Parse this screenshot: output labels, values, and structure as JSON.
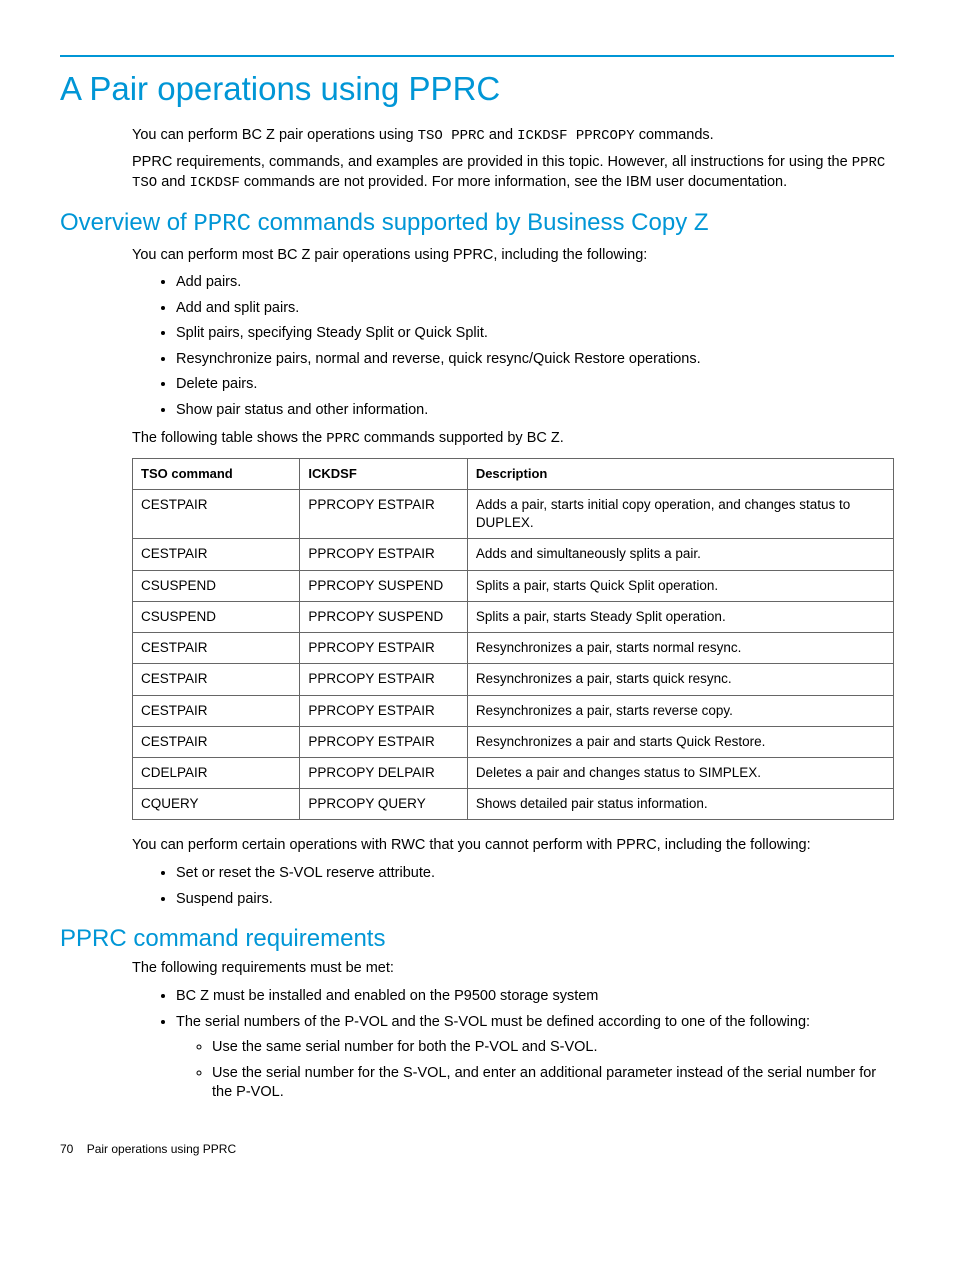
{
  "title": "A Pair operations using PPRC",
  "intro": {
    "p1_pre": "You can perform BC Z pair operations using ",
    "p1_code1": "TSO PPRC",
    "p1_mid": " and ",
    "p1_code2": "ICKDSF PPRCOPY",
    "p1_post": " commands.",
    "p2_pre": "PPRC requirements, commands, and examples are provided in this topic. However, all instructions for using the ",
    "p2_code1": "PPRC TSO",
    "p2_mid": " and ",
    "p2_code2": "ICKDSF",
    "p2_post": " commands are not provided. For more information, see the IBM user documentation."
  },
  "overview": {
    "heading_pre": "Overview of ",
    "heading_code": "PPRC",
    "heading_post": " commands supported by Business Copy Z",
    "intro": "You can perform most BC Z pair operations using PPRC, including the following:",
    "bullets": {
      "b1": "Add pairs.",
      "b2": "Add and split pairs.",
      "b3": "Split pairs, specifying Steady Split or Quick Split.",
      "b4": "Resynchronize pairs, normal and reverse, quick resync/Quick Restore operations.",
      "b5": "Delete pairs.",
      "b6": "Show pair status and other information."
    },
    "table_intro_pre": "The following table shows the ",
    "table_intro_code": "PPRC",
    "table_intro_post": " commands supported by BC Z.",
    "table": {
      "headers": {
        "h1": "TSO command",
        "h2": "ICKDSF",
        "h3": "Description"
      },
      "rows": {
        "r0": {
          "c1": "CESTPAIR",
          "c2": "PPRCOPY ESTPAIR",
          "c3": "Adds a pair, starts initial copy operation, and changes status to DUPLEX."
        },
        "r1": {
          "c1": "CESTPAIR",
          "c2": "PPRCOPY ESTPAIR",
          "c3": "Adds and simultaneously splits a pair."
        },
        "r2": {
          "c1": "CSUSPEND",
          "c2": "PPRCOPY SUSPEND",
          "c3": "Splits a pair, starts Quick Split operation."
        },
        "r3": {
          "c1": "CSUSPEND",
          "c2": "PPRCOPY SUSPEND",
          "c3": "Splits a pair, starts Steady Split operation."
        },
        "r4": {
          "c1": "CESTPAIR",
          "c2": "PPRCOPY ESTPAIR",
          "c3": "Resynchronizes a pair, starts normal resync."
        },
        "r5": {
          "c1": "CESTPAIR",
          "c2": "PPRCOPY ESTPAIR",
          "c3": "Resynchronizes a pair, starts quick resync."
        },
        "r6": {
          "c1": "CESTPAIR",
          "c2": "PPRCOPY ESTPAIR",
          "c3": "Resynchronizes a pair, starts reverse copy."
        },
        "r7": {
          "c1": "CESTPAIR",
          "c2": "PPRCOPY ESTPAIR",
          "c3": "Resynchronizes a pair and starts Quick Restore."
        },
        "r8": {
          "c1": "CDELPAIR",
          "c2": "PPRCOPY DELPAIR",
          "c3": "Deletes a pair and changes status to SIMPLEX."
        },
        "r9": {
          "c1": "CQUERY",
          "c2": "PPRCOPY QUERY",
          "c3": "Shows detailed pair status information."
        }
      }
    },
    "rwc_intro": "You can perform certain operations with RWC that you cannot perform with PPRC, including the following:",
    "rwc_bullets": {
      "b1": "Set or reset the S-VOL reserve attribute.",
      "b2": "Suspend pairs."
    }
  },
  "requirements": {
    "heading": "PPRC command requirements",
    "intro": "The following requirements must be met:",
    "bullets": {
      "b1": "BC Z must be installed and enabled on the P9500 storage system",
      "b2": "The serial numbers of the P-VOL and the S-VOL must be defined according to one of the following:",
      "sub": {
        "s1": "Use the same serial number for both the P-VOL and S-VOL.",
        "s2": "Use the serial number for the S-VOL, and enter an additional parameter instead of the serial number for the P-VOL."
      }
    }
  },
  "footer": {
    "page": "70",
    "title": "Pair operations using PPRC"
  }
}
